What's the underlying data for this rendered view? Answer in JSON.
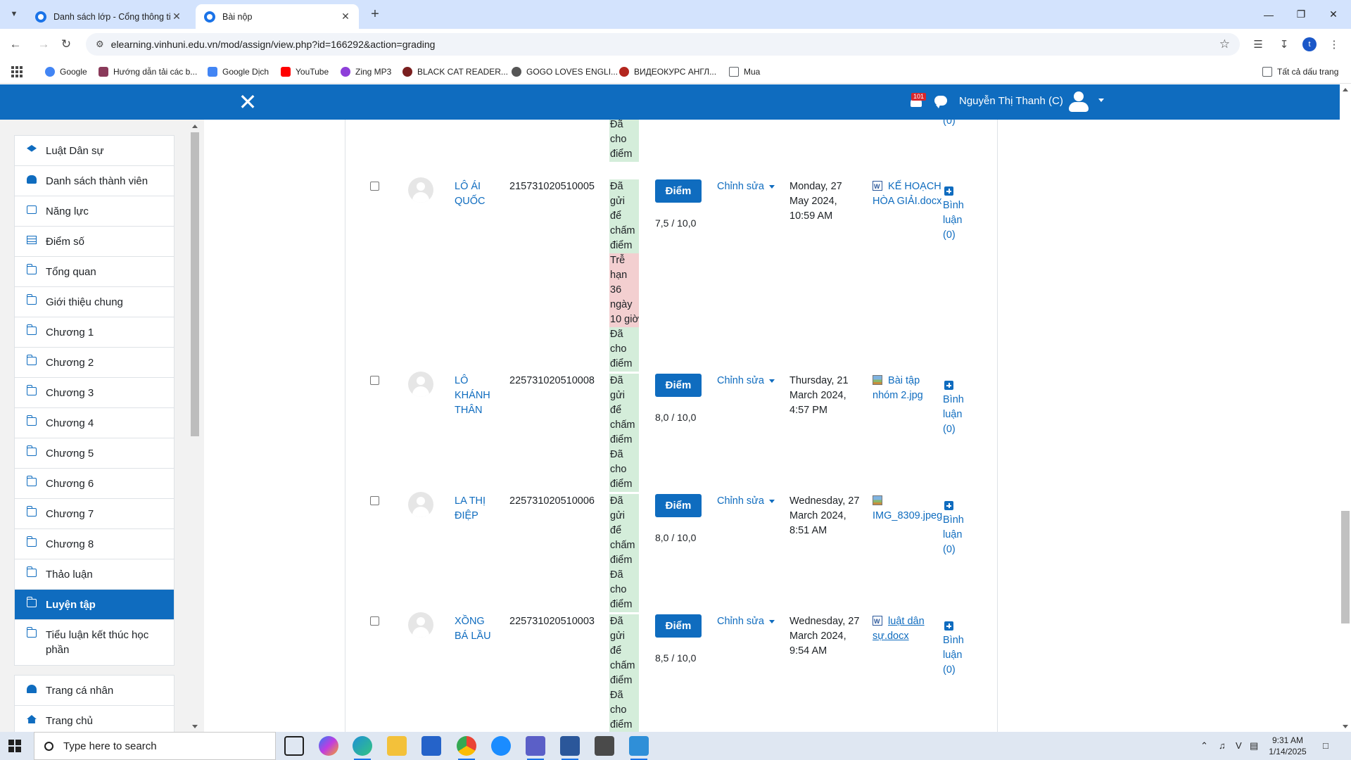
{
  "browser": {
    "tabs": [
      {
        "label": "Danh sách lớp - Cổng thông tin",
        "active": false
      },
      {
        "label": "Bài nộp",
        "active": true
      }
    ],
    "url": "elearning.vinhuni.edu.vn/mod/assign/view.php?id=166292&action=grading",
    "bookmarks": [
      {
        "label": "Google",
        "color": "#4285f4"
      },
      {
        "label": "Hướng dẫn tải các b...",
        "color": "#8a3a5a"
      },
      {
        "label": "Google Dịch",
        "color": "#4285f4"
      },
      {
        "label": "YouTube",
        "color": "#ff0000"
      },
      {
        "label": "Zing MP3",
        "color": "#8d3fd9"
      },
      {
        "label": "BLACK CAT READER...",
        "color": "#7a1f1f"
      },
      {
        "label": "GOGO LOVES ENGLI...",
        "color": "#555555"
      },
      {
        "label": "ВИДЕОКУРС АНГЛ...",
        "color": "#b3261e"
      },
      {
        "label": "Mua",
        "color": "#5f6368"
      }
    ],
    "all_bookmarks": "Tất cả dấu trang",
    "profile_initial": "t"
  },
  "header": {
    "notification_count": "101",
    "user_name": "Nguyễn Thị Thanh (C)"
  },
  "sidebar": {
    "items": [
      {
        "label": "Luật Dân sự",
        "icon": "graduation-cap-icon"
      },
      {
        "label": "Danh sách thành viên",
        "icon": "users-icon"
      },
      {
        "label": "Năng lực",
        "icon": "check-square-icon"
      },
      {
        "label": "Điểm số",
        "icon": "table-icon"
      },
      {
        "label": "Tổng quan",
        "icon": "folder-icon"
      },
      {
        "label": "Giới thiệu chung",
        "icon": "folder-icon"
      },
      {
        "label": "Chương 1",
        "icon": "folder-icon"
      },
      {
        "label": "Chương 2",
        "icon": "folder-icon"
      },
      {
        "label": "Chương 3",
        "icon": "folder-icon"
      },
      {
        "label": "Chương 4",
        "icon": "folder-icon"
      },
      {
        "label": "Chương 5",
        "icon": "folder-icon"
      },
      {
        "label": "Chương 6",
        "icon": "folder-icon"
      },
      {
        "label": "Chương 7",
        "icon": "folder-icon"
      },
      {
        "label": "Chương 8",
        "icon": "folder-icon"
      },
      {
        "label": "Thảo luận",
        "icon": "folder-icon"
      },
      {
        "label": "Luyện tập",
        "icon": "folder-icon",
        "active": true
      },
      {
        "label": "Tiểu luận kết thúc học phần",
        "icon": "folder-icon"
      }
    ],
    "secondary": [
      {
        "label": "Trang cá nhân",
        "icon": "dashboard-icon"
      },
      {
        "label": "Trang chủ",
        "icon": "home-icon"
      }
    ]
  },
  "grading": {
    "top_partial_status": [
      "Đã",
      "cho",
      "điểm"
    ],
    "top_partial_comment": "(0)",
    "grade_button_label": "Điểm",
    "edit_label": "Chỉnh sửa",
    "rows": [
      {
        "name": "LÔ ÁI QUỐC",
        "student_id": "215731020510005",
        "status_submitted": [
          "Đã",
          "gửi để",
          "chấm",
          "điểm"
        ],
        "status_late": [
          "Trễ",
          "hạn",
          "36",
          "ngày",
          "10 giờ"
        ],
        "status_graded": [
          "Đã",
          "cho",
          "điểm"
        ],
        "grade": "7,5 / 10,0",
        "modified": "Monday, 27 May 2024, 10:59 AM",
        "file": "KẾ HOẠCH HÒA GIẢI.docx",
        "file_type": "word",
        "comment": "Bình luận (0)"
      },
      {
        "name": "LÔ KHÁNH THÂN",
        "student_id": "225731020510008",
        "status_submitted": [
          "Đã",
          "gửi để",
          "chấm",
          "điểm"
        ],
        "status_late": [],
        "status_graded": [
          "Đã",
          "cho",
          "điểm"
        ],
        "grade": "8,0 / 10,0",
        "modified": "Thursday, 21 March 2024, 4:57 PM",
        "file": "Bài tập nhóm 2.jpg",
        "file_type": "image",
        "comment": "Bình luận (0)"
      },
      {
        "name": "LA THỊ ĐIỆP",
        "student_id": "225731020510006",
        "status_submitted": [
          "Đã",
          "gửi để",
          "chấm",
          "điểm"
        ],
        "status_late": [],
        "status_graded": [
          "Đã",
          "cho",
          "điểm"
        ],
        "grade": "8,0 / 10,0",
        "modified": "Wednesday, 27 March 2024, 8:51 AM",
        "file": "IMG_8309.jpeg",
        "file_type": "image",
        "comment": "Bình luận (0)"
      },
      {
        "name": "XỒNG BÁ LẦU",
        "student_id": "225731020510003",
        "status_submitted": [
          "Đã",
          "gửi để",
          "chấm",
          "điểm"
        ],
        "status_late": [],
        "status_graded": [
          "Đã",
          "cho",
          "điểm"
        ],
        "grade": "8,5 / 10,0",
        "modified": "Wednesday, 27 March 2024, 9:54 AM",
        "file": "luật dân sự.docx",
        "file_type": "word",
        "comment": "Bình luận (0)"
      }
    ]
  },
  "taskbar": {
    "search_placeholder": "Type here to search",
    "time": "9:31 AM",
    "date": "1/14/2025"
  }
}
